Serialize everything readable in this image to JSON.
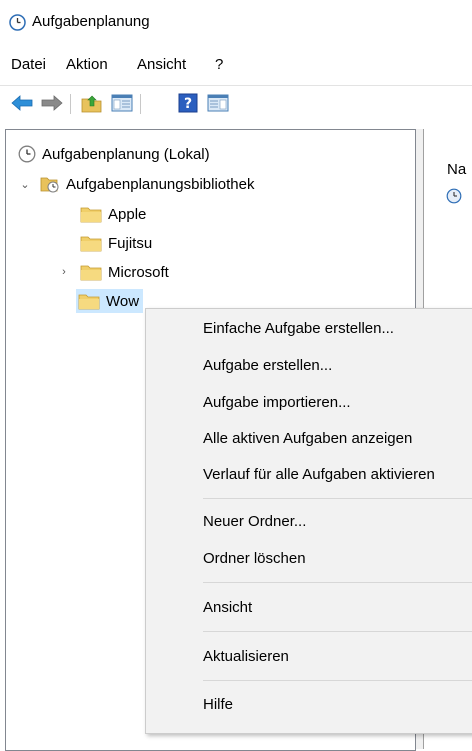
{
  "window": {
    "title": "Aufgabenplanung"
  },
  "menu": {
    "items": [
      "Datei",
      "Aktion",
      "Ansicht",
      "?"
    ]
  },
  "toolbar": {
    "buttons": [
      {
        "icon": "back-arrow-icon"
      },
      {
        "icon": "forward-arrow-icon"
      },
      {
        "icon": "up-folder-icon"
      },
      {
        "icon": "show-hide-console-tree-icon"
      },
      {
        "icon": "help-icon"
      },
      {
        "icon": "show-hide-action-pane-icon"
      }
    ]
  },
  "tree": {
    "root": "Aufgabenplanung (Lokal)",
    "library": "Aufgabenplanungsbibliothek",
    "folders": [
      "Apple",
      "Fujitsu",
      "Microsoft",
      "Wow"
    ],
    "selected": "Wow"
  },
  "right_pane": {
    "column_header": "Na"
  },
  "context_menu": {
    "items": [
      "Einfache Aufgabe erstellen...",
      "Aufgabe erstellen...",
      "Aufgabe importieren...",
      "Alle aktiven Aufgaben anzeigen",
      "Verlauf für alle Aufgaben aktivieren",
      "Neuer Ordner...",
      "Ordner löschen",
      "Ansicht",
      "Aktualisieren",
      "Hilfe"
    ]
  },
  "colors": {
    "selection": "#cce8ff",
    "folder": "#e8c25c",
    "menu_bg": "#f2f2f2"
  }
}
